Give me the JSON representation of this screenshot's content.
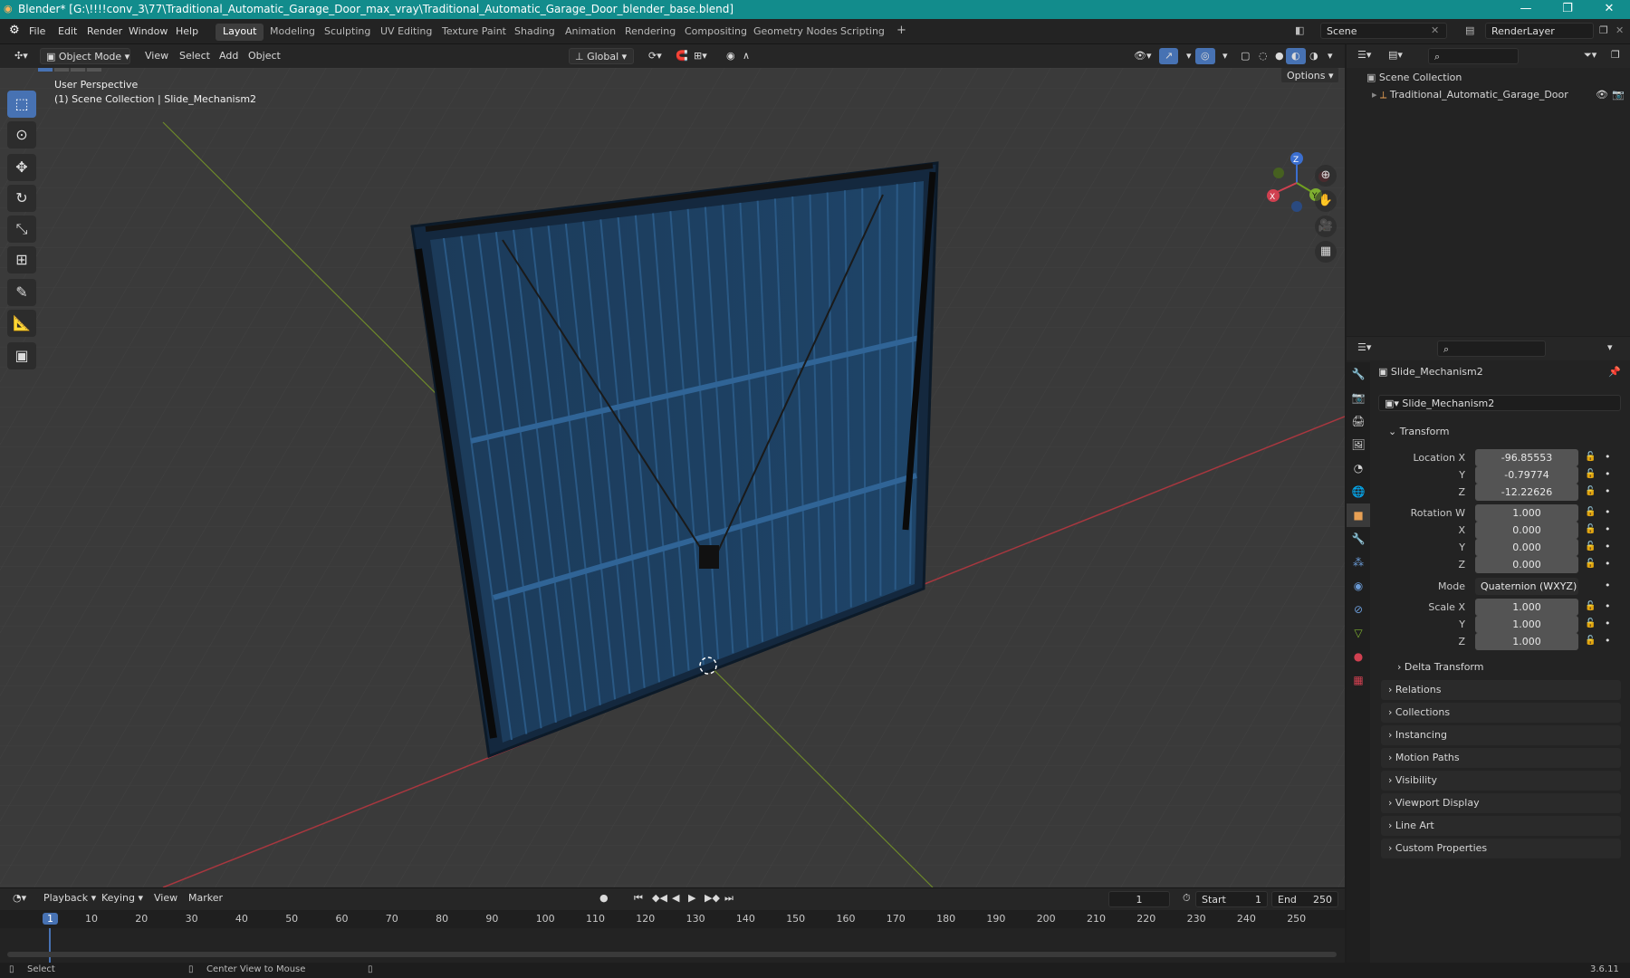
{
  "window": {
    "title": "Blender* [G:\\!!!!conv_3\\77\\Traditional_Automatic_Garage_Door_max_vray\\Traditional_Automatic_Garage_Door_blender_base.blend]",
    "minimize": "—",
    "maximize": "❐",
    "close": "✕"
  },
  "menu": {
    "items": [
      "File",
      "Edit",
      "Render",
      "Window",
      "Help"
    ]
  },
  "workspaces": [
    "Layout",
    "Modeling",
    "Sculpting",
    "UV Editing",
    "Texture Paint",
    "Shading",
    "Animation",
    "Rendering",
    "Compositing",
    "Geometry Nodes",
    "Scripting"
  ],
  "scene": {
    "label": "Scene",
    "render_layer": "RenderLayer"
  },
  "viewport": {
    "mode": "Object Mode",
    "menu": [
      "View",
      "Select",
      "Add",
      "Object"
    ],
    "orientation": "Global",
    "options": "Options",
    "perspective": "User Perspective",
    "collection_info": "(1) Scene Collection | Slide_Mechanism2",
    "gizmo": {
      "x": "X",
      "y": "Y",
      "z": "Z"
    }
  },
  "outliner": {
    "root": "Scene Collection",
    "item": "Traditional_Automatic_Garage_Door"
  },
  "properties": {
    "object_name": "Slide_Mechanism2",
    "data_name": "Slide_Mechanism2",
    "transform_label": "Transform",
    "location": {
      "label": "Location X",
      "x": "-96.85553",
      "y": "-0.79774",
      "z": "-12.22626"
    },
    "rotation": {
      "label": "Rotation W",
      "w": "1.000",
      "x": "0.000",
      "y": "0.000",
      "z": "0.000"
    },
    "mode": {
      "label": "Mode",
      "value": "Quaternion (WXYZ)"
    },
    "scale": {
      "label": "Scale X",
      "x": "1.000",
      "y": "1.000",
      "z": "1.000"
    },
    "axis": {
      "y": "Y",
      "z": "Z",
      "x": "X"
    },
    "sections": [
      "Delta Transform",
      "Relations",
      "Collections",
      "Instancing",
      "Motion Paths",
      "Visibility",
      "Viewport Display",
      "Line Art",
      "Custom Properties"
    ]
  },
  "timeline": {
    "menu": [
      "Playback",
      "Keying",
      "View",
      "Marker"
    ],
    "current_frame": "1",
    "start_label": "Start",
    "start": "1",
    "end_label": "End",
    "end": "250",
    "ticks": [
      "1",
      "10",
      "20",
      "30",
      "40",
      "50",
      "60",
      "70",
      "80",
      "90",
      "100",
      "110",
      "120",
      "130",
      "140",
      "150",
      "160",
      "170",
      "180",
      "190",
      "200",
      "210",
      "220",
      "230",
      "240",
      "250"
    ]
  },
  "status": {
    "select": "Select",
    "center": "Center View to Mouse",
    "version": "3.6.11"
  }
}
